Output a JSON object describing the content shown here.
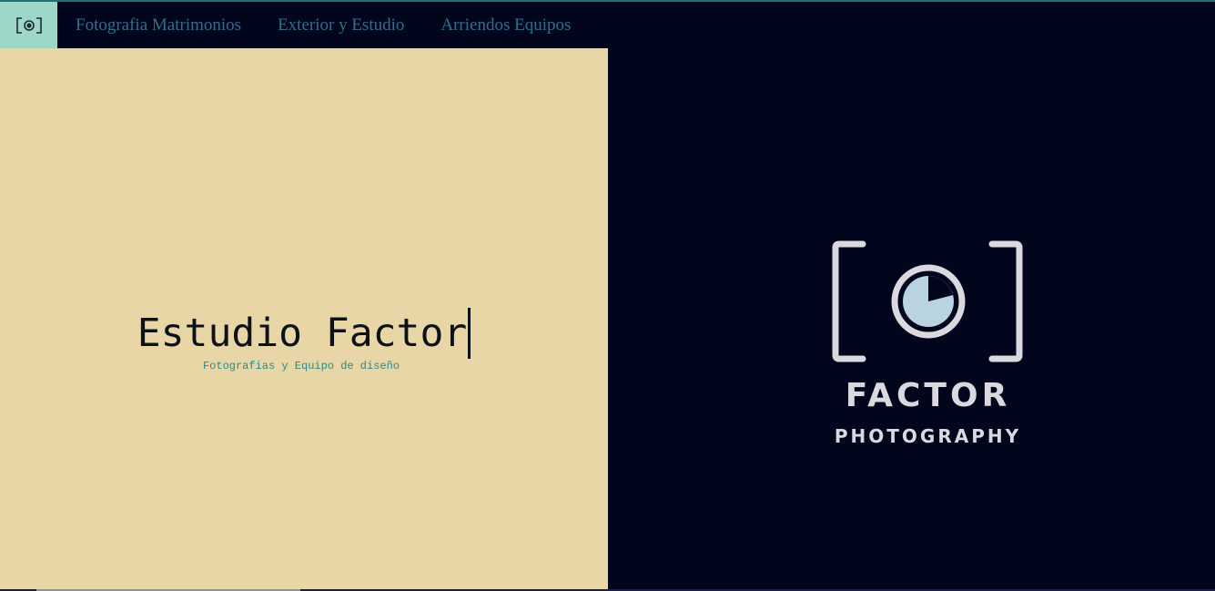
{
  "nav": {
    "logo_icon": "camera-icon",
    "links": [
      {
        "label": "Fotografia Matrimonios"
      },
      {
        "label": "Exterior y Estudio"
      },
      {
        "label": "Arriendos Equipos"
      }
    ]
  },
  "hero": {
    "title": "Estudio Factor",
    "subtitle": "Fotografias y Equipo de diseño"
  },
  "brand": {
    "name": "FACTOR",
    "tagline": "PHOTOGRAPHY",
    "logo_icon": "camera-icon"
  },
  "colors": {
    "nav_background": "#02061c",
    "logo_tile": "#9dd7c7",
    "nav_link": "#2f6f8c",
    "left_panel": "#e9d6a6",
    "subtitle": "#2a8a85",
    "brand_text": "#d9d9df",
    "lens_fill": "#b9d3e0"
  }
}
